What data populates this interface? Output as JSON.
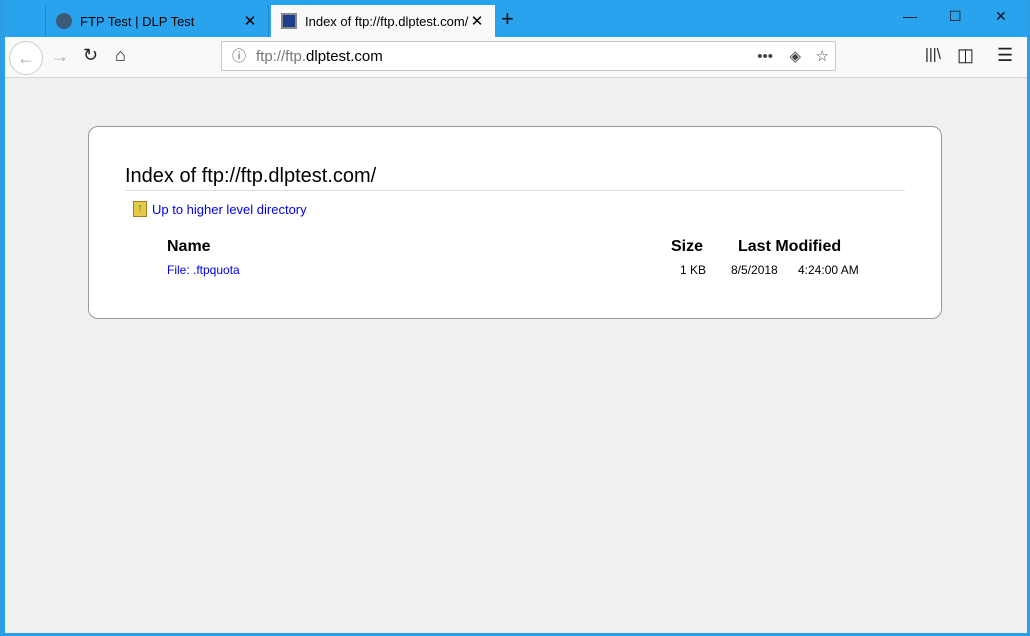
{
  "colors": {
    "tabbar": "#2aa3ef",
    "link": "#0000ee"
  },
  "tabs": [
    {
      "label": "FTP Test | DLP Test",
      "icon": "dlptest-icon"
    },
    {
      "label": "Index of ftp://ftp.dlptest.com/",
      "icon": "monitor-icon"
    }
  ],
  "urlbar": {
    "prefix": "ftp://ftp.",
    "domain": "dlptest.com"
  },
  "page": {
    "title": "Index of ftp://ftp.dlptest.com/",
    "up_link": "Up to higher level directory",
    "columns": {
      "name": "Name",
      "size": "Size",
      "modified": "Last Modified"
    },
    "rows": [
      {
        "name": "File: .ftpquota",
        "size": "1 KB",
        "date": "8/5/2018",
        "time": "4:24:00 AM"
      }
    ]
  }
}
